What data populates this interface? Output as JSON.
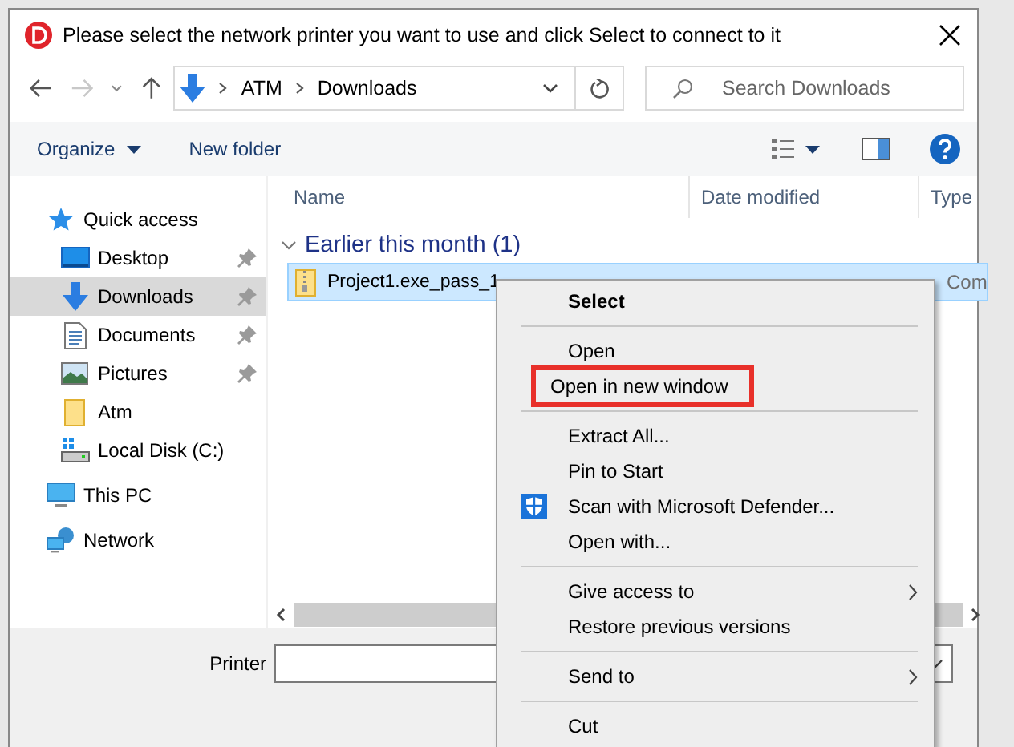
{
  "window": {
    "title": "Please select the network printer you want to use and click Select to connect to it"
  },
  "nav": {
    "back_disabled": false,
    "forward_disabled": true,
    "path": [
      "ATM",
      "Downloads"
    ],
    "search": {
      "placeholder": "Search Downloads"
    }
  },
  "toolbar": {
    "buttons": [
      "Organize",
      "New folder"
    ]
  },
  "sidebar": {
    "items": [
      {
        "label": "Quick access",
        "kind": "star",
        "selected": false,
        "children": [
          {
            "label": "Desktop",
            "kind": "desktop",
            "pinned": true,
            "selected": false
          },
          {
            "label": "Downloads",
            "kind": "download",
            "pinned": true,
            "selected": true
          },
          {
            "label": "Documents",
            "kind": "document",
            "pinned": true,
            "selected": false
          },
          {
            "label": "Pictures",
            "kind": "picture",
            "pinned": true,
            "selected": false
          },
          {
            "label": "Atm",
            "kind": "folder",
            "pinned": false,
            "selected": false
          },
          {
            "label": "Local Disk (C:)",
            "kind": "disk",
            "pinned": false,
            "selected": false
          }
        ]
      },
      {
        "label": "This PC",
        "kind": "pc",
        "selected": false
      },
      {
        "label": "Network",
        "kind": "network",
        "selected": false
      }
    ]
  },
  "file_list": {
    "columns": [
      "Name",
      "Date modified",
      "Type"
    ],
    "groups": [
      {
        "title": "Earlier this month (1)",
        "expanded": true,
        "rows": [
          {
            "name": "Project1.exe_pass_1",
            "type": "Com",
            "selected": true
          }
        ]
      }
    ]
  },
  "printer_field": {
    "label": "Printer"
  },
  "context_menu": {
    "items": [
      {
        "kind": "item",
        "label": "Select",
        "default": true
      },
      {
        "kind": "separator"
      },
      {
        "kind": "item",
        "label": "Open"
      },
      {
        "kind": "item",
        "label": "Open in new window",
        "highlighted": true
      },
      {
        "kind": "separator"
      },
      {
        "kind": "item",
        "label": "Extract All..."
      },
      {
        "kind": "item",
        "label": "Pin to Start"
      },
      {
        "kind": "shield_item",
        "label": "Scan with Microsoft Defender..."
      },
      {
        "kind": "item",
        "label": "Open with..."
      },
      {
        "kind": "separator"
      },
      {
        "kind": "item",
        "label": "Give access to",
        "submenu": true
      },
      {
        "kind": "item",
        "label": "Restore previous versions"
      },
      {
        "kind": "separator"
      },
      {
        "kind": "item",
        "label": "Send to",
        "submenu": true
      },
      {
        "kind": "separator"
      },
      {
        "kind": "item",
        "label": "Cut"
      }
    ]
  }
}
